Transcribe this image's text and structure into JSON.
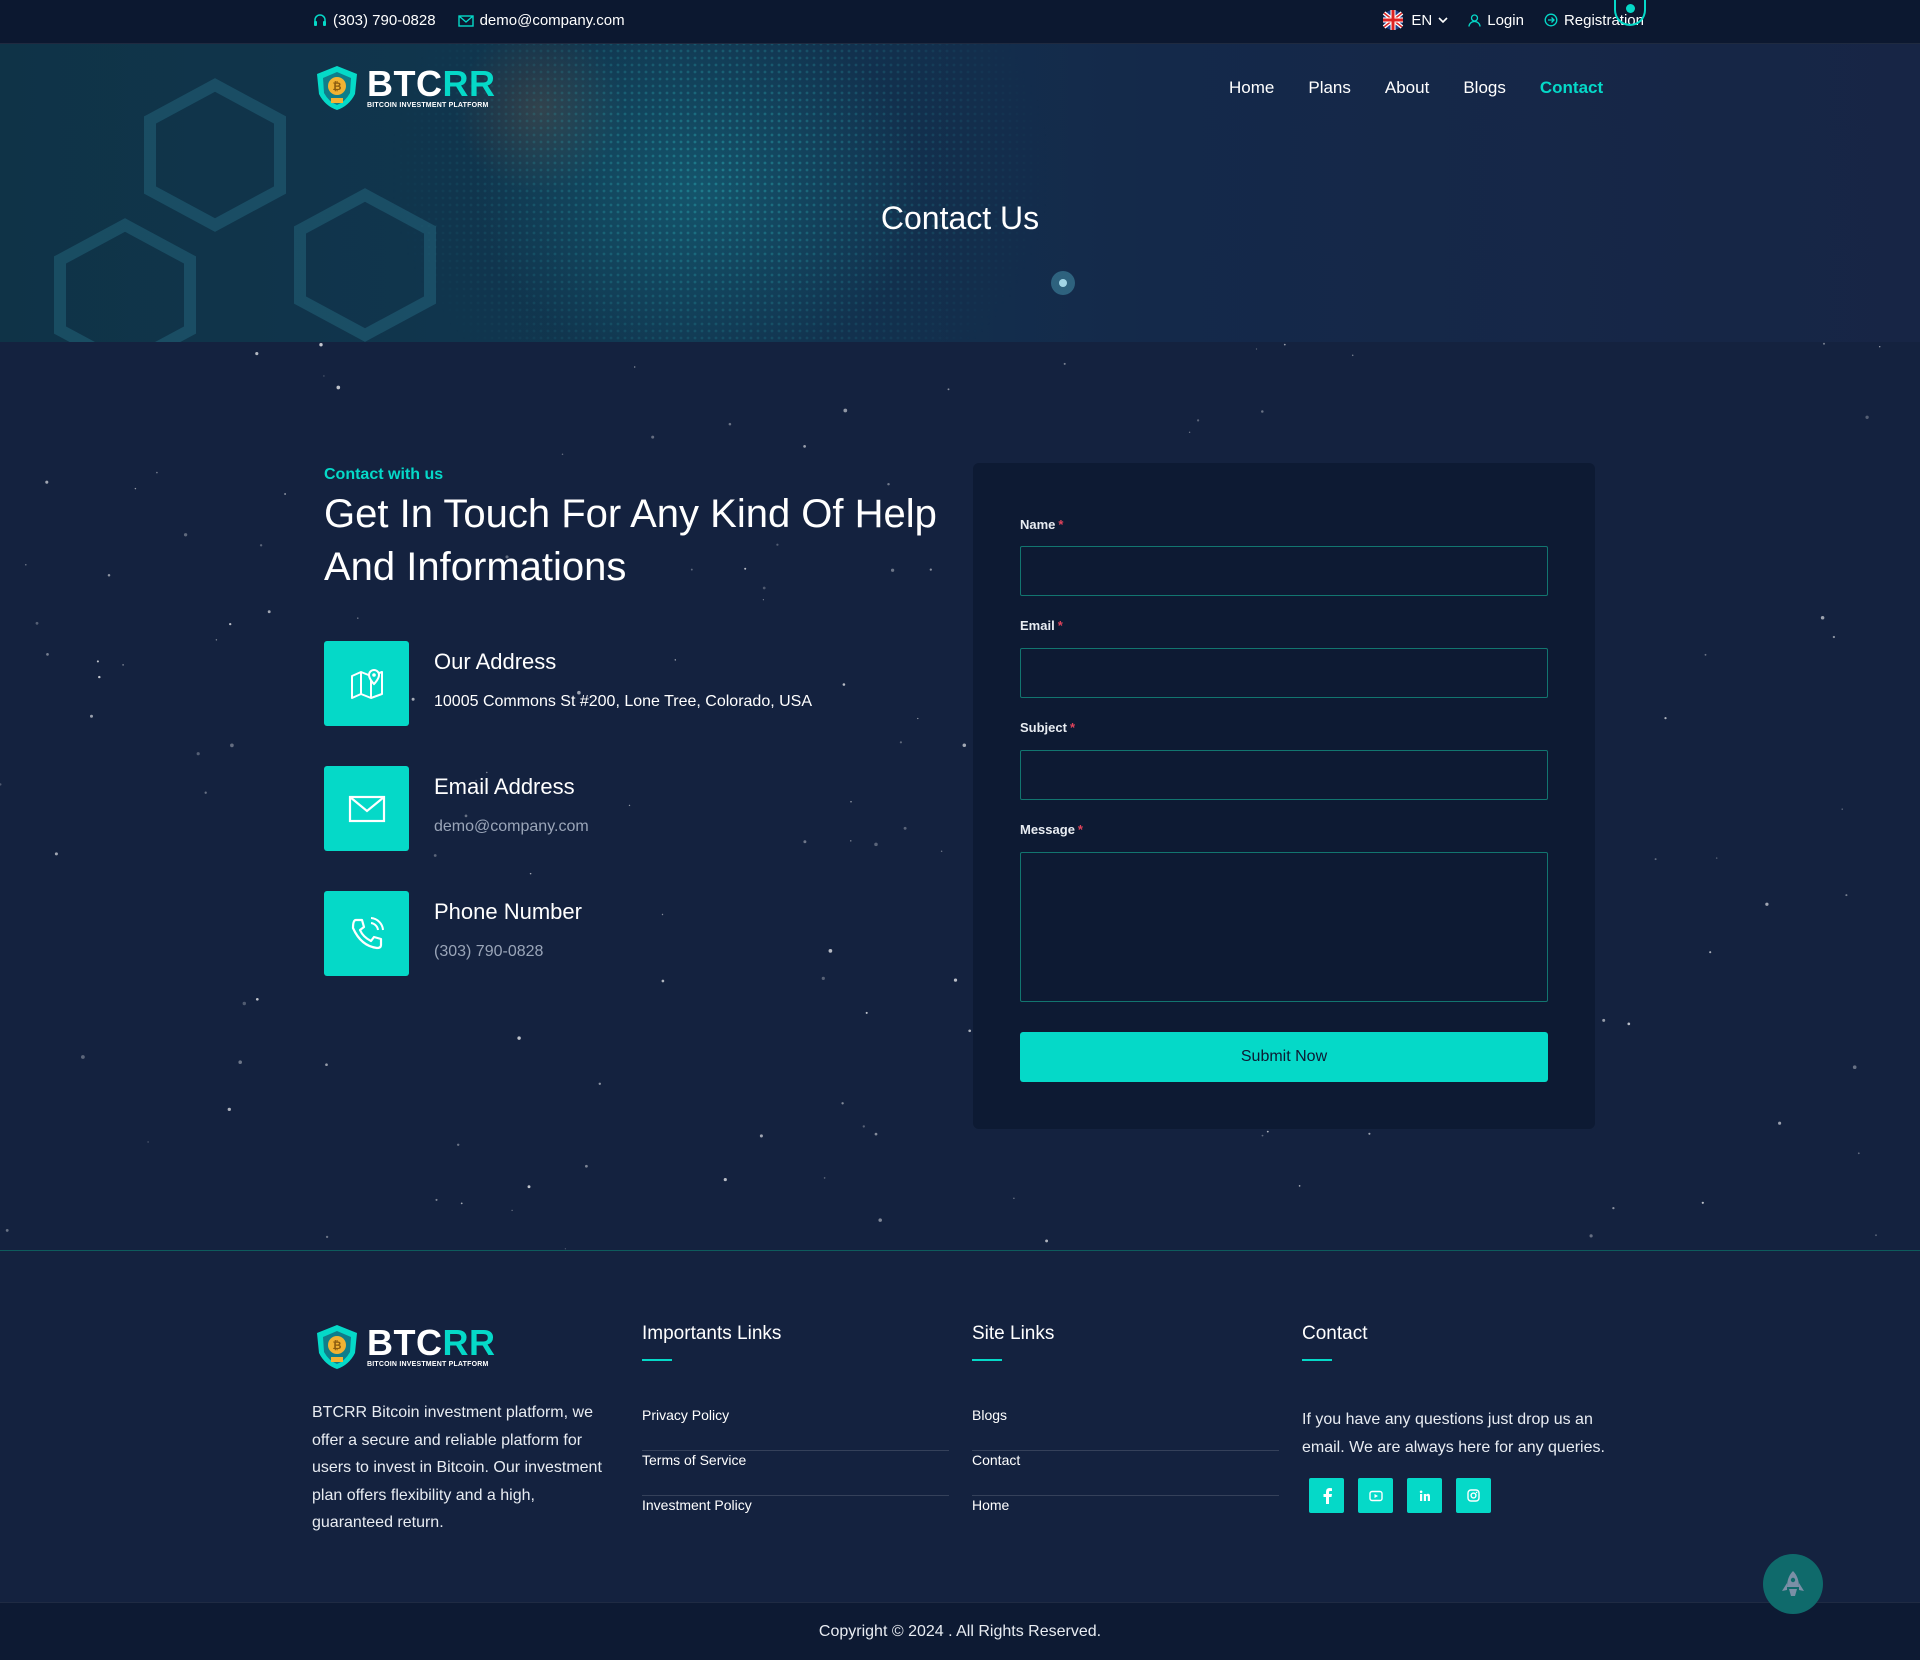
{
  "topbar": {
    "phone": "(303) 790-0828",
    "email": "demo@company.com",
    "language": "EN",
    "login": "Login",
    "registration": "Registration"
  },
  "brand": {
    "name_part1": "BTC",
    "name_part2": "RR",
    "tagline": "BITCOIN INVESTMENT PLATFORM",
    "accent_color": "#05d9c8"
  },
  "nav": {
    "items": [
      {
        "label": "Home"
      },
      {
        "label": "Plans"
      },
      {
        "label": "About"
      },
      {
        "label": "Blogs"
      },
      {
        "label": "Contact",
        "active": true
      }
    ]
  },
  "hero": {
    "title": "Contact Us"
  },
  "contact": {
    "eyebrow": "Contact with us",
    "heading": "Get In Touch For Any Kind Of Help And Informations",
    "info": [
      {
        "icon": "map-pin-icon",
        "title": "Our Address",
        "value": "10005 Commons St #200, Lone Tree, Colorado, USA"
      },
      {
        "icon": "mail-icon",
        "title": "Email Address",
        "value": "demo@company.com"
      },
      {
        "icon": "phone-icon",
        "title": "Phone Number",
        "value": "(303) 790-0828"
      }
    ]
  },
  "form": {
    "name_label": "Name",
    "email_label": "Email",
    "subject_label": "Subject",
    "message_label": "Message",
    "required_mark": "*",
    "name_value": "",
    "email_value": "",
    "subject_value": "",
    "message_value": "",
    "submit_label": "Submit Now"
  },
  "footer": {
    "about": "BTCRR Bitcoin investment platform, we offer a secure and reliable platform for users to invest in Bitcoin. Our investment plan offers flexibility and a high, guaranteed return.",
    "important_links": {
      "title": "Importants Links",
      "items": [
        "Privacy Policy",
        "Terms of Service",
        "Investment Policy"
      ]
    },
    "site_links": {
      "title": "Site Links",
      "items": [
        "Blogs",
        "Contact",
        "Home"
      ]
    },
    "contact": {
      "title": "Contact",
      "text": "If you have any questions just drop us an email. We are always here for any queries.",
      "socials": [
        "facebook-icon",
        "youtube-icon",
        "linkedin-icon",
        "instagram-icon"
      ]
    },
    "copyright": "Copyright © 2024 . All Rights Reserved."
  }
}
